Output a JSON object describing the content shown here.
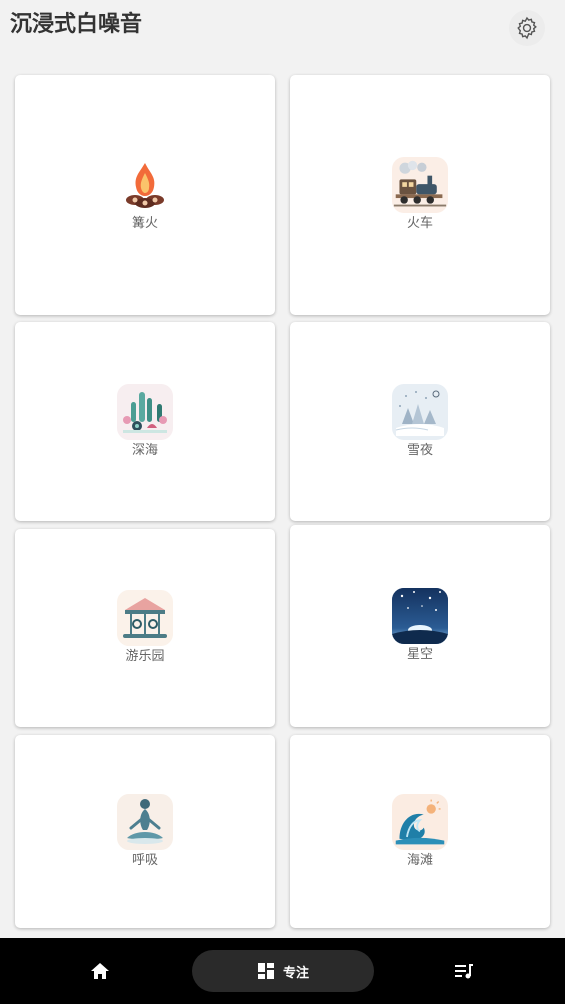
{
  "header": {
    "title": "沉浸式白噪音",
    "settings_icon": "gear-icon"
  },
  "cards": [
    {
      "label": "篝火",
      "icon": "campfire-icon"
    },
    {
      "label": "火车",
      "icon": "train-icon"
    },
    {
      "label": "深海",
      "icon": "deep-sea-icon"
    },
    {
      "label": "雪夜",
      "icon": "snowy-night-icon"
    },
    {
      "label": "游乐园",
      "icon": "carousel-icon"
    },
    {
      "label": "星空",
      "icon": "starry-sky-icon"
    },
    {
      "label": "呼吸",
      "icon": "meditation-icon"
    },
    {
      "label": "海滩",
      "icon": "wave-icon"
    }
  ],
  "bottom_nav": {
    "home_icon": "home-icon",
    "focus_icon": "grid-icon",
    "focus_label": "专注",
    "playlist_icon": "playlist-icon"
  },
  "colors": {
    "background": "#f2f2f2",
    "card": "#ffffff",
    "nav_bar": "#000000",
    "nav_active_pill": "#2a2a2a"
  }
}
